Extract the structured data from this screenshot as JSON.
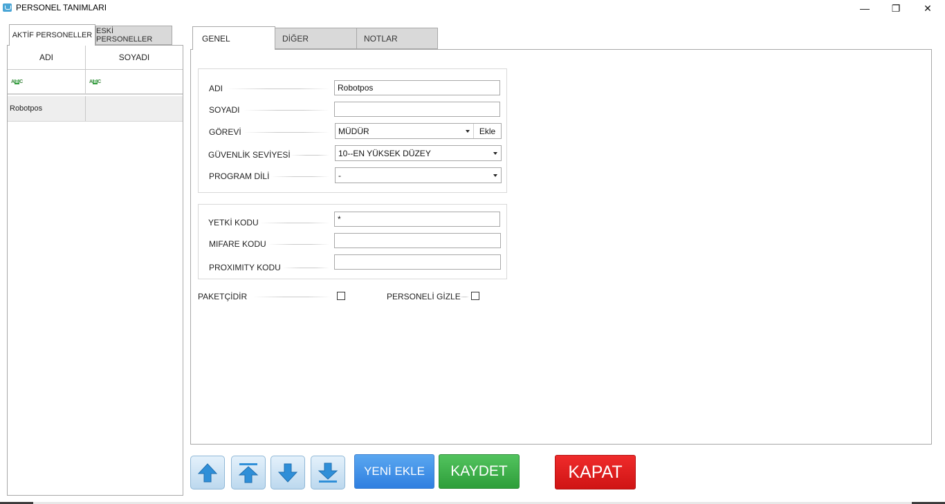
{
  "window": {
    "title": "PERSONEL TANIMLARI",
    "min_glyph": "—",
    "max_glyph": "❐",
    "close_glyph": "✕"
  },
  "left": {
    "tabs": [
      "AKTİF PERSONELLER",
      "ESKİ PERSONELLER"
    ],
    "columns": [
      "ADI",
      "SOYADI"
    ],
    "filter_icon": "abc-filter-icon",
    "rows": [
      {
        "adi": "Robotpos",
        "soyadi": ""
      }
    ]
  },
  "right": {
    "tabs": [
      "GENEL",
      "DİĞER",
      "NOTLAR"
    ],
    "form": {
      "adi_label": "ADI",
      "adi_value": "Robotpos",
      "soyadi_label": "SOYADI",
      "soyadi_value": "",
      "gorevi_label": "GÖREVİ",
      "gorevi_value": "MÜDÜR",
      "ekle_label": "Ekle",
      "guvenlik_label": "GÜVENLİK SEVİYESİ",
      "guvenlik_value": "10--EN YÜKSEK DÜZEY",
      "dil_label": "PROGRAM DİLİ",
      "dil_value": "-",
      "yetki_label": "YETKİ KODU",
      "yetki_value": "*",
      "mifare_label": "MIFARE KODU",
      "mifare_value": "",
      "proximity_label": "PROXIMITY KODU",
      "proximity_value": "",
      "paketci_label": "PAKETÇİDİR",
      "paketci_checked": false,
      "gizle_label": "PERSONELİ GİZLE",
      "gizle_checked": false
    }
  },
  "buttons": {
    "nav_icons": [
      "arrow-up-icon",
      "arrow-to-top-icon",
      "arrow-down-icon",
      "arrow-to-bottom-icon"
    ],
    "new_label": "YENİ EKLE",
    "save_label": "KAYDET",
    "close_label": "KAPAT"
  },
  "colors": {
    "new": "#3b8be6",
    "save": "#3aae46",
    "close": "#e01d1d",
    "nav_icon": "#2f8fd8"
  }
}
